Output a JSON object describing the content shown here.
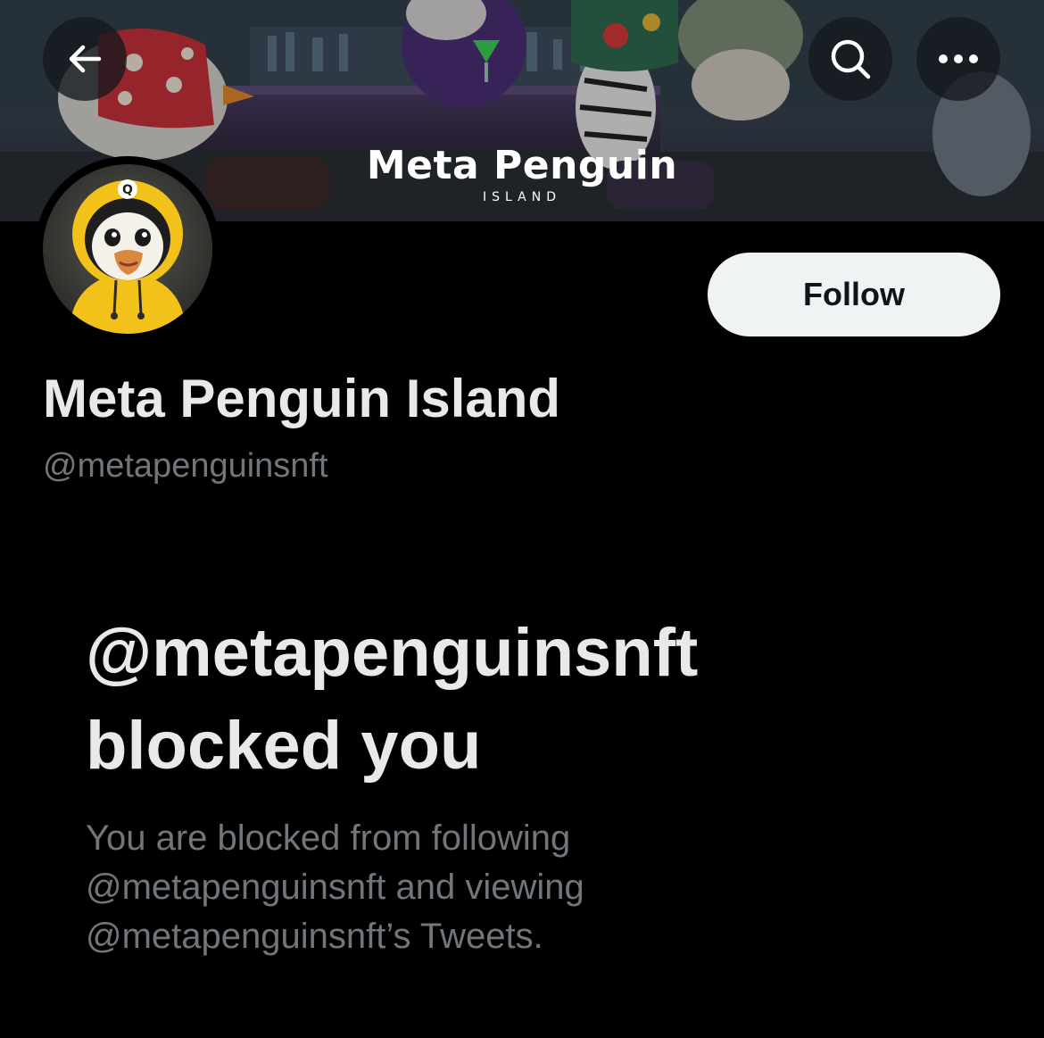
{
  "banner": {
    "logo_text": "Meta Penguin",
    "logo_subtext": "ISLAND"
  },
  "header": {
    "back_icon": "arrow-left-icon",
    "search_icon": "search-icon",
    "more_icon": "more-horizontal-icon"
  },
  "profile": {
    "display_name": "Meta Penguin Island",
    "handle": "@metapenguinsnft",
    "follow_label": "Follow"
  },
  "blocked": {
    "title_line1": "@metapenguinsnft",
    "title_line2": "blocked you",
    "desc_line1": "You are blocked from following",
    "desc_line2": "@metapenguinsnft and viewing",
    "desc_line3": "@metapenguinsnft’s Tweets."
  },
  "colors": {
    "background": "#000000",
    "primary_text": "#e7e9ea",
    "secondary_text": "#71767b",
    "follow_bg": "#eff3f4",
    "follow_text": "#0f1419",
    "hoodie_yellow": "#f2c21b"
  }
}
